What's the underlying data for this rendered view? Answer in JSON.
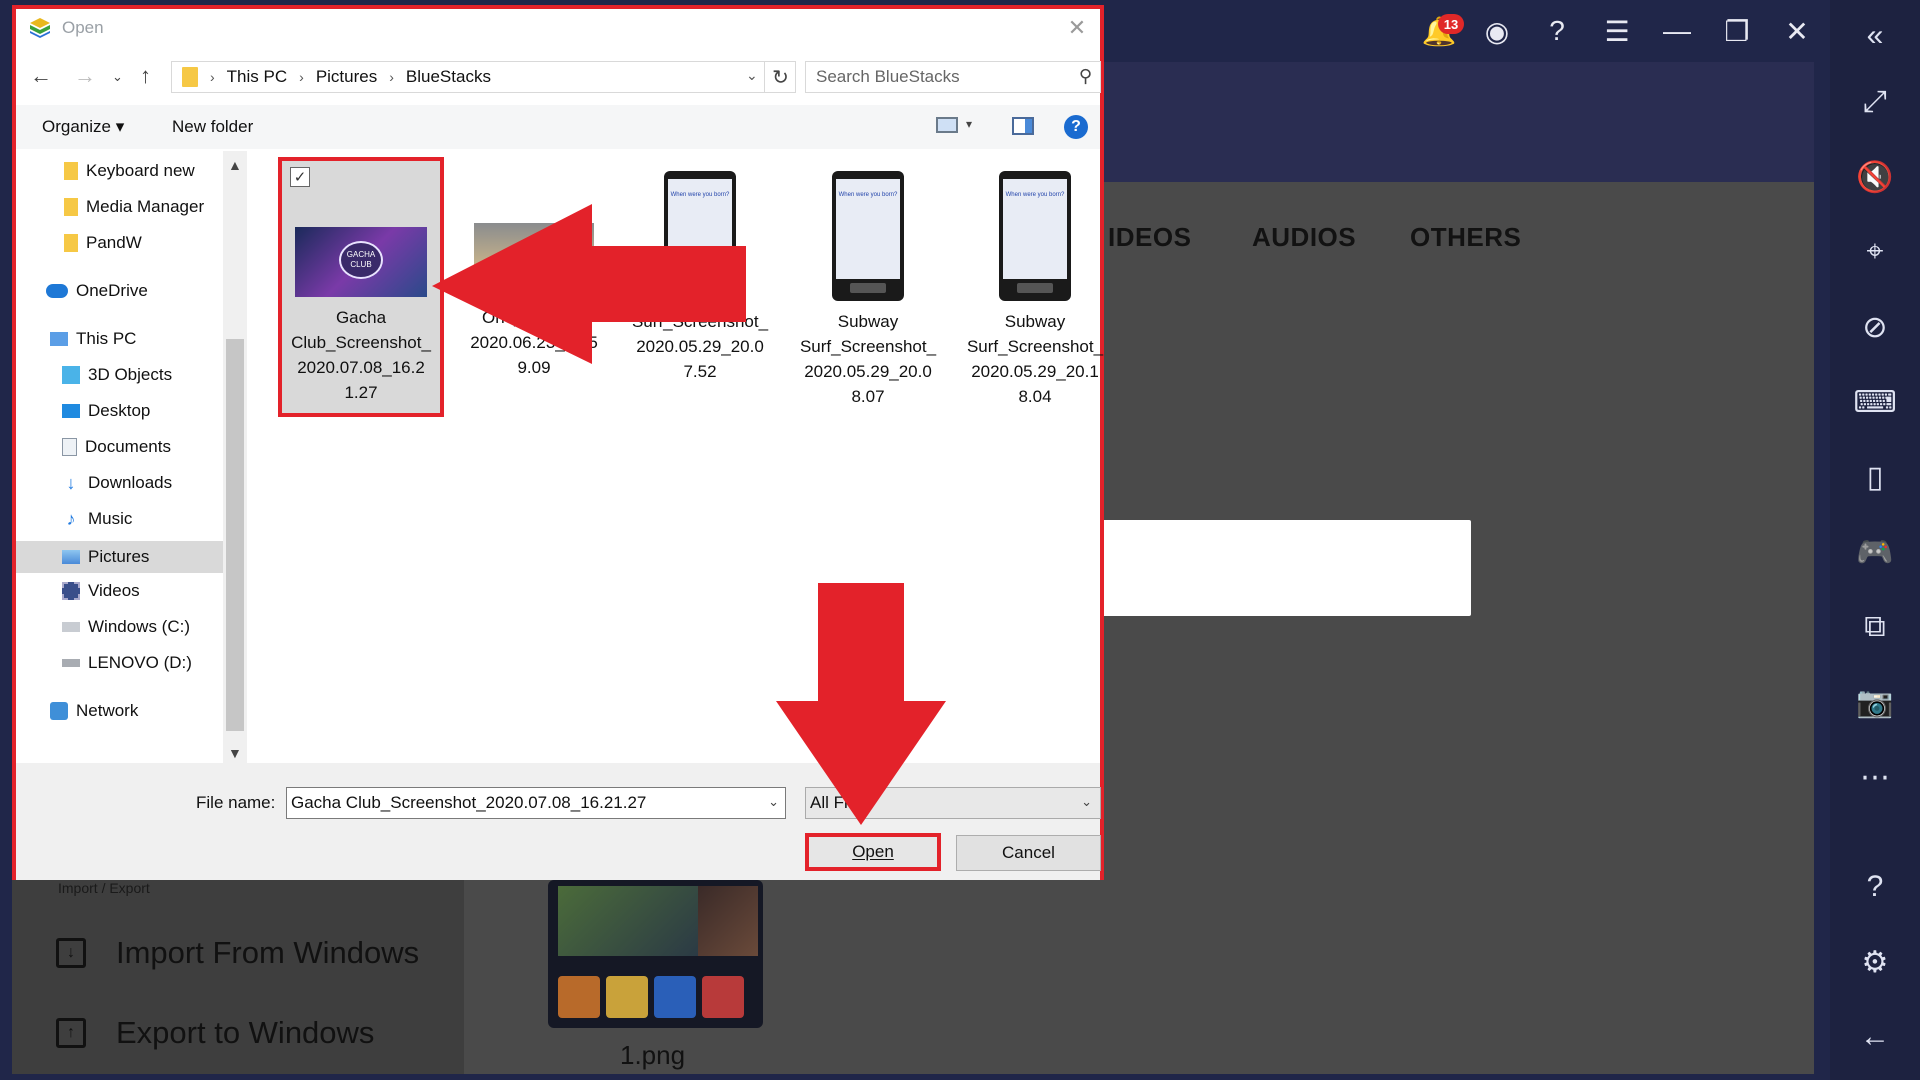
{
  "dialog": {
    "title": "Open",
    "breadcrumb": [
      "This PC",
      "Pictures",
      "BlueStacks"
    ],
    "search_placeholder": "Search BlueStacks",
    "toolbar": {
      "organize": "Organize",
      "new_folder": "New folder"
    },
    "nav_items": [
      {
        "label": "Keyboard new",
        "icon": "folder-icon"
      },
      {
        "label": "Media Manager",
        "icon": "folder-icon"
      },
      {
        "label": "PandW",
        "icon": "folder-icon"
      },
      {
        "label": "OneDrive",
        "icon": "cloud-icon"
      },
      {
        "label": "This PC",
        "icon": "computer-icon"
      },
      {
        "label": "3D Objects",
        "icon": "cube-icon"
      },
      {
        "label": "Desktop",
        "icon": "desktop-icon"
      },
      {
        "label": "Documents",
        "icon": "document-icon"
      },
      {
        "label": "Downloads",
        "icon": "download-icon"
      },
      {
        "label": "Music",
        "icon": "music-icon"
      },
      {
        "label": "Pictures",
        "icon": "pictures-icon"
      },
      {
        "label": "Videos",
        "icon": "videos-icon"
      },
      {
        "label": "Windows (C:)",
        "icon": "drive-icon"
      },
      {
        "label": "LENOVO (D:)",
        "icon": "drive-icon"
      },
      {
        "label": "Network",
        "icon": "network-icon"
      }
    ],
    "files": [
      {
        "line1": "Gacha",
        "line2": "Club_Screenshot_",
        "line3": "2020.07.08_16.2",
        "line4": "1.27"
      },
      {
        "line1": "",
        "line2": "One_Screens",
        "line3": "2020.06.23_10.5",
        "line4": "9.09"
      },
      {
        "line1": "",
        "line2": "Surf_Screenshot_",
        "line3": "2020.05.29_20.0",
        "line4": "7.52"
      },
      {
        "line1": "Subway",
        "line2": "Surf_Screenshot_",
        "line3": "2020.05.29_20.0",
        "line4": "8.07"
      },
      {
        "line1": "Subway",
        "line2": "Surf_Screenshot_",
        "line3": "2020.05.29_20.1",
        "line4": "8.04"
      }
    ],
    "file_name_label": "File name:",
    "file_name_value": "Gacha Club_Screenshot_2020.07.08_16.21.27",
    "file_type_value": "All Fi",
    "open_label": "Open",
    "cancel_label": "Cancel",
    "gacha_logo_text": "GACHA CLUB",
    "phone_text": "When were you born?"
  },
  "bluestacks": {
    "notification_count": "13",
    "tabs": [
      "IDEOS",
      "AUDIOS",
      "OTHERS"
    ],
    "import_export_label": "Import / Export",
    "import_label": "Import From Windows",
    "export_label": "Export to Windows",
    "thumb_caption": "1.png"
  },
  "colors": {
    "highlight_red": "#e3222a",
    "bluestacks_bg": "#202649",
    "app_gray": "#4a4a4a"
  }
}
